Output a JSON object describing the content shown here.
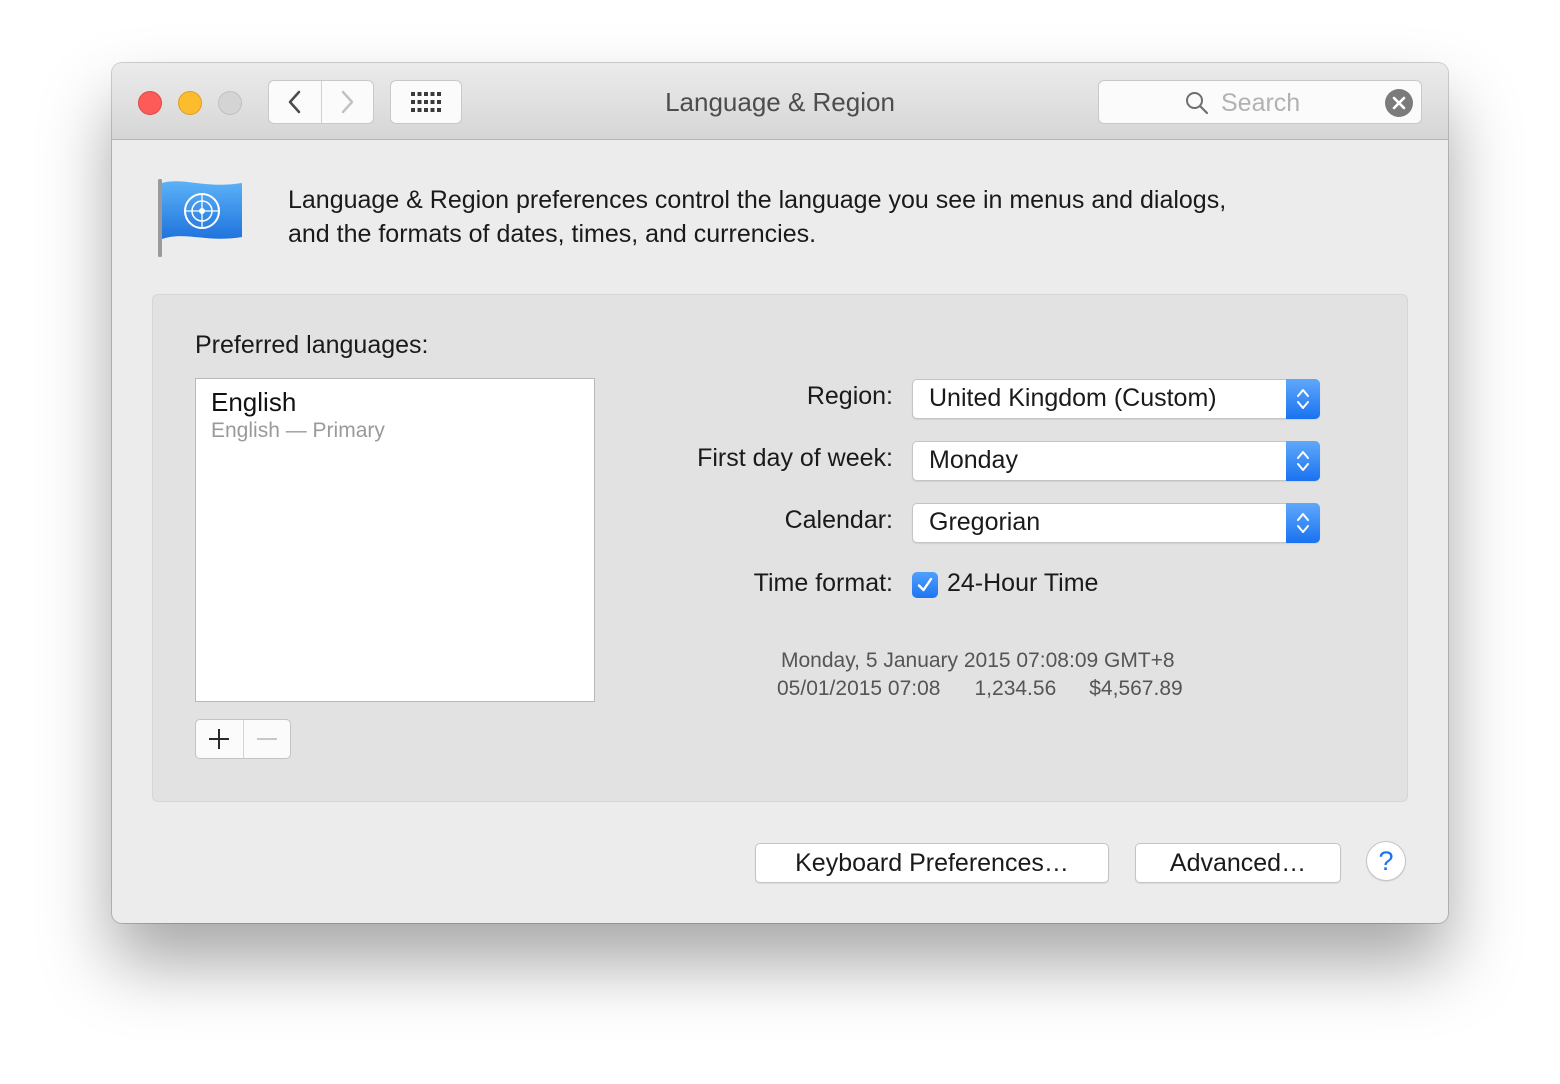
{
  "window": {
    "title": "Language & Region"
  },
  "toolbar": {
    "search_placeholder": "Search",
    "icons": [
      "back-icon",
      "forward-icon",
      "grid-icon",
      "search-icon",
      "clear-icon"
    ]
  },
  "header": {
    "description_line1": "Language & Region preferences control the language you see in menus and dialogs,",
    "description_line2": "and the formats of dates, times, and currencies."
  },
  "languages": {
    "label": "Preferred languages:",
    "items": [
      {
        "name": "English",
        "detail": "English — Primary"
      }
    ],
    "add_label": "+",
    "remove_label": "—"
  },
  "settings": {
    "region_label": "Region:",
    "region_value": "United Kingdom (Custom)",
    "first_day_label": "First day of week:",
    "first_day_value": "Monday",
    "calendar_label": "Calendar:",
    "calendar_value": "Gregorian",
    "time_format_label": "Time format:",
    "time_format_option": "24-Hour Time",
    "time_format_checked": true
  },
  "sample": {
    "long_date": "Monday, 5 January 2015 07:08:09 GMT+8",
    "short_date": "05/01/2015 07:08",
    "number": "1,234.56",
    "currency": "$4,567.89"
  },
  "footer": {
    "keyboard_button": "Keyboard Preferences…",
    "advanced_button": "Advanced…",
    "help_label": "?"
  },
  "colors": {
    "accent": "#1d74f2",
    "close": "#fc5b57",
    "minimize": "#fdbc2e"
  }
}
